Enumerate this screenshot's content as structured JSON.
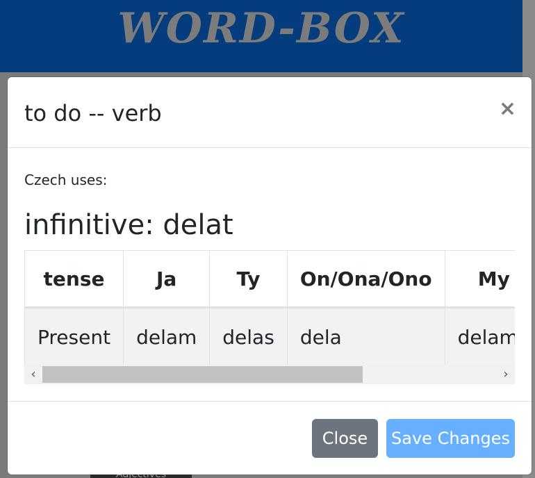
{
  "page": {
    "logo": "WORD-BOX",
    "bg_tag": "Adjectives"
  },
  "modal": {
    "title": "to do -- verb",
    "close_glyph": "×",
    "czech_label": "Czech uses:",
    "infinitive": "infinitive: delat",
    "table": {
      "headers": [
        "tense",
        "Ja",
        "Ty",
        "On/Ona/Ono",
        "My",
        ""
      ],
      "rows": [
        [
          "Present",
          "delam",
          "delas",
          "dela",
          "delame",
          ""
        ]
      ]
    },
    "scrollbar": {
      "left_arrow": "‹",
      "right_arrow": "›"
    },
    "footer": {
      "close_label": "Close",
      "save_label": "Save Changes"
    }
  },
  "colors": {
    "header_bg": "#053c7e",
    "close_btn": "#6c757d",
    "save_btn": "#66b0ff"
  }
}
